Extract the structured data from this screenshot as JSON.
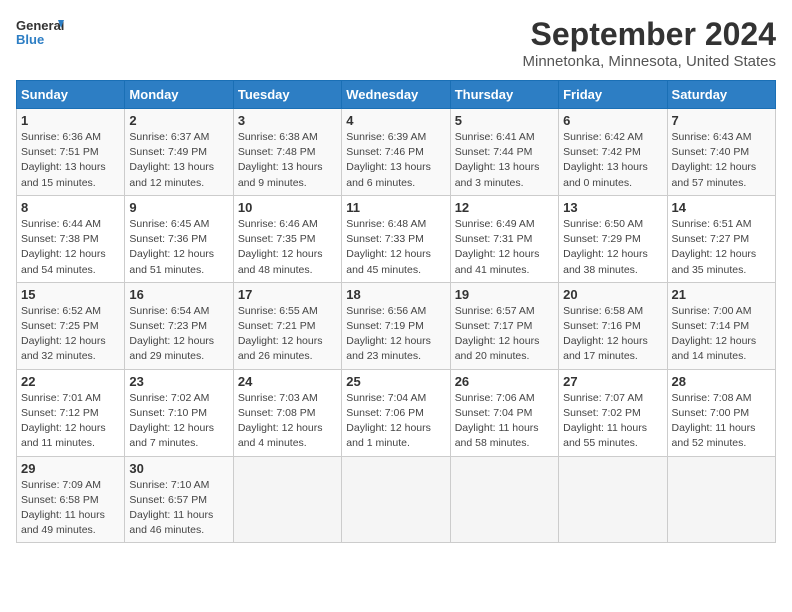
{
  "logo": {
    "line1": "General",
    "line2": "Blue"
  },
  "title": "September 2024",
  "location": "Minnetonka, Minnesota, United States",
  "weekdays": [
    "Sunday",
    "Monday",
    "Tuesday",
    "Wednesday",
    "Thursday",
    "Friday",
    "Saturday"
  ],
  "weeks": [
    [
      {
        "day": "1",
        "sunrise": "Sunrise: 6:36 AM",
        "sunset": "Sunset: 7:51 PM",
        "daylight": "Daylight: 13 hours and 15 minutes."
      },
      {
        "day": "2",
        "sunrise": "Sunrise: 6:37 AM",
        "sunset": "Sunset: 7:49 PM",
        "daylight": "Daylight: 13 hours and 12 minutes."
      },
      {
        "day": "3",
        "sunrise": "Sunrise: 6:38 AM",
        "sunset": "Sunset: 7:48 PM",
        "daylight": "Daylight: 13 hours and 9 minutes."
      },
      {
        "day": "4",
        "sunrise": "Sunrise: 6:39 AM",
        "sunset": "Sunset: 7:46 PM",
        "daylight": "Daylight: 13 hours and 6 minutes."
      },
      {
        "day": "5",
        "sunrise": "Sunrise: 6:41 AM",
        "sunset": "Sunset: 7:44 PM",
        "daylight": "Daylight: 13 hours and 3 minutes."
      },
      {
        "day": "6",
        "sunrise": "Sunrise: 6:42 AM",
        "sunset": "Sunset: 7:42 PM",
        "daylight": "Daylight: 13 hours and 0 minutes."
      },
      {
        "day": "7",
        "sunrise": "Sunrise: 6:43 AM",
        "sunset": "Sunset: 7:40 PM",
        "daylight": "Daylight: 12 hours and 57 minutes."
      }
    ],
    [
      {
        "day": "8",
        "sunrise": "Sunrise: 6:44 AM",
        "sunset": "Sunset: 7:38 PM",
        "daylight": "Daylight: 12 hours and 54 minutes."
      },
      {
        "day": "9",
        "sunrise": "Sunrise: 6:45 AM",
        "sunset": "Sunset: 7:36 PM",
        "daylight": "Daylight: 12 hours and 51 minutes."
      },
      {
        "day": "10",
        "sunrise": "Sunrise: 6:46 AM",
        "sunset": "Sunset: 7:35 PM",
        "daylight": "Daylight: 12 hours and 48 minutes."
      },
      {
        "day": "11",
        "sunrise": "Sunrise: 6:48 AM",
        "sunset": "Sunset: 7:33 PM",
        "daylight": "Daylight: 12 hours and 45 minutes."
      },
      {
        "day": "12",
        "sunrise": "Sunrise: 6:49 AM",
        "sunset": "Sunset: 7:31 PM",
        "daylight": "Daylight: 12 hours and 41 minutes."
      },
      {
        "day": "13",
        "sunrise": "Sunrise: 6:50 AM",
        "sunset": "Sunset: 7:29 PM",
        "daylight": "Daylight: 12 hours and 38 minutes."
      },
      {
        "day": "14",
        "sunrise": "Sunrise: 6:51 AM",
        "sunset": "Sunset: 7:27 PM",
        "daylight": "Daylight: 12 hours and 35 minutes."
      }
    ],
    [
      {
        "day": "15",
        "sunrise": "Sunrise: 6:52 AM",
        "sunset": "Sunset: 7:25 PM",
        "daylight": "Daylight: 12 hours and 32 minutes."
      },
      {
        "day": "16",
        "sunrise": "Sunrise: 6:54 AM",
        "sunset": "Sunset: 7:23 PM",
        "daylight": "Daylight: 12 hours and 29 minutes."
      },
      {
        "day": "17",
        "sunrise": "Sunrise: 6:55 AM",
        "sunset": "Sunset: 7:21 PM",
        "daylight": "Daylight: 12 hours and 26 minutes."
      },
      {
        "day": "18",
        "sunrise": "Sunrise: 6:56 AM",
        "sunset": "Sunset: 7:19 PM",
        "daylight": "Daylight: 12 hours and 23 minutes."
      },
      {
        "day": "19",
        "sunrise": "Sunrise: 6:57 AM",
        "sunset": "Sunset: 7:17 PM",
        "daylight": "Daylight: 12 hours and 20 minutes."
      },
      {
        "day": "20",
        "sunrise": "Sunrise: 6:58 AM",
        "sunset": "Sunset: 7:16 PM",
        "daylight": "Daylight: 12 hours and 17 minutes."
      },
      {
        "day": "21",
        "sunrise": "Sunrise: 7:00 AM",
        "sunset": "Sunset: 7:14 PM",
        "daylight": "Daylight: 12 hours and 14 minutes."
      }
    ],
    [
      {
        "day": "22",
        "sunrise": "Sunrise: 7:01 AM",
        "sunset": "Sunset: 7:12 PM",
        "daylight": "Daylight: 12 hours and 11 minutes."
      },
      {
        "day": "23",
        "sunrise": "Sunrise: 7:02 AM",
        "sunset": "Sunset: 7:10 PM",
        "daylight": "Daylight: 12 hours and 7 minutes."
      },
      {
        "day": "24",
        "sunrise": "Sunrise: 7:03 AM",
        "sunset": "Sunset: 7:08 PM",
        "daylight": "Daylight: 12 hours and 4 minutes."
      },
      {
        "day": "25",
        "sunrise": "Sunrise: 7:04 AM",
        "sunset": "Sunset: 7:06 PM",
        "daylight": "Daylight: 12 hours and 1 minute."
      },
      {
        "day": "26",
        "sunrise": "Sunrise: 7:06 AM",
        "sunset": "Sunset: 7:04 PM",
        "daylight": "Daylight: 11 hours and 58 minutes."
      },
      {
        "day": "27",
        "sunrise": "Sunrise: 7:07 AM",
        "sunset": "Sunset: 7:02 PM",
        "daylight": "Daylight: 11 hours and 55 minutes."
      },
      {
        "day": "28",
        "sunrise": "Sunrise: 7:08 AM",
        "sunset": "Sunset: 7:00 PM",
        "daylight": "Daylight: 11 hours and 52 minutes."
      }
    ],
    [
      {
        "day": "29",
        "sunrise": "Sunrise: 7:09 AM",
        "sunset": "Sunset: 6:58 PM",
        "daylight": "Daylight: 11 hours and 49 minutes."
      },
      {
        "day": "30",
        "sunrise": "Sunrise: 7:10 AM",
        "sunset": "Sunset: 6:57 PM",
        "daylight": "Daylight: 11 hours and 46 minutes."
      },
      null,
      null,
      null,
      null,
      null
    ]
  ]
}
